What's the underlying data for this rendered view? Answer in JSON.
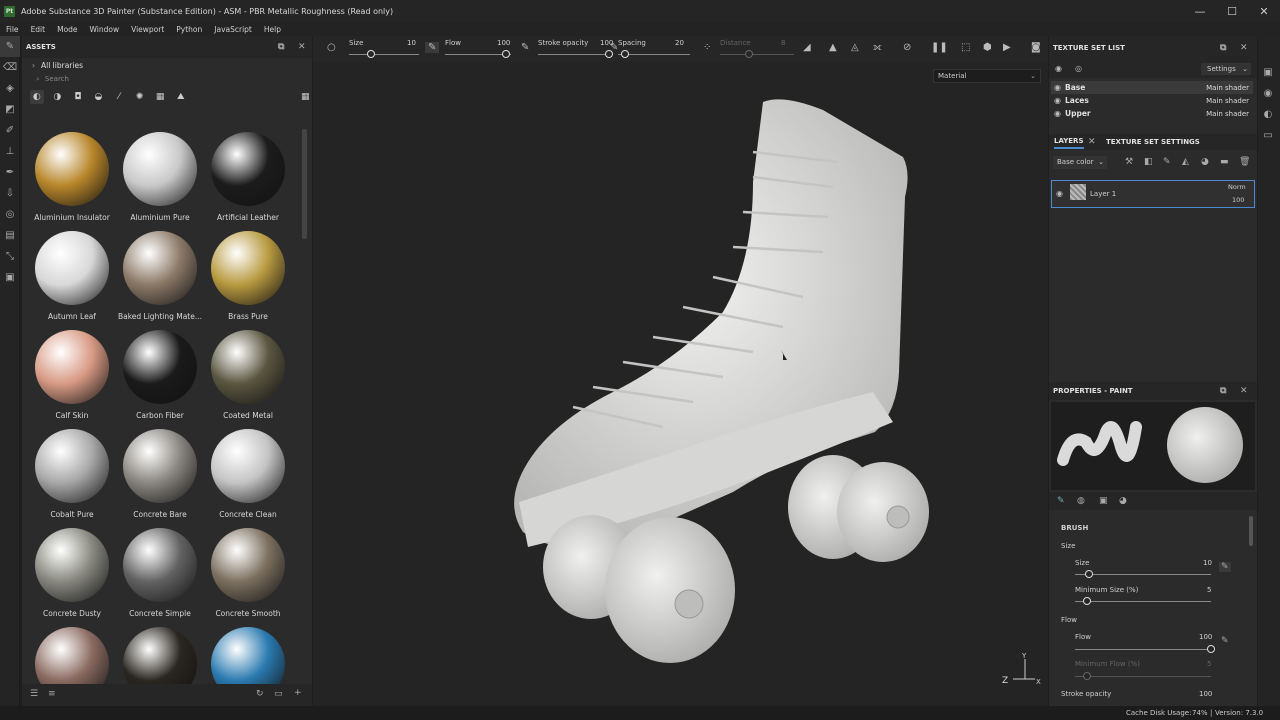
{
  "window": {
    "title": "Adobe Substance 3D Painter (Substance Edition) - ASM - PBR Metallic Roughness (Read only)",
    "icon_text": "Pt",
    "minimize_glyph": "—",
    "maximize_glyph": "☐",
    "close_glyph": "✕"
  },
  "menu": [
    "File",
    "Edit",
    "Mode",
    "Window",
    "Viewport",
    "Python",
    "JavaScript",
    "Help"
  ],
  "assets": {
    "title": "ASSETS",
    "library": "All libraries",
    "search_placeholder": "Search",
    "materials": [
      {
        "label": "Aluminium Insulator",
        "color": "#b8862a"
      },
      {
        "label": "Aluminium Pure",
        "color": "#c8c8c8"
      },
      {
        "label": "Artificial Leather",
        "color": "#1c1c1c"
      },
      {
        "label": "Autumn Leaf",
        "color": "#d8d8d8"
      },
      {
        "label": "Baked Lighting Mate...",
        "color": "#8c7a68"
      },
      {
        "label": "Brass Pure",
        "color": "#b89a40"
      },
      {
        "label": "Calf Skin",
        "color": "#d89a84"
      },
      {
        "label": "Carbon Fiber",
        "color": "#1a1a1a"
      },
      {
        "label": "Coated Metal",
        "color": "#5a5640"
      },
      {
        "label": "Cobalt Pure",
        "color": "#a8a8a8"
      },
      {
        "label": "Concrete Bare",
        "color": "#8a8680"
      },
      {
        "label": "Concrete Clean",
        "color": "#c4c4c4"
      },
      {
        "label": "Concrete Dusty",
        "color": "#888880"
      },
      {
        "label": "Concrete Simple",
        "color": "#626262"
      },
      {
        "label": "Concrete Smooth",
        "color": "#7c7060"
      },
      {
        "label": "",
        "color": "#8a6a60"
      },
      {
        "label": "",
        "color": "#2a2620"
      },
      {
        "label": "",
        "color": "#2a7ab0"
      }
    ]
  },
  "toolbar": {
    "size_label": "Size",
    "size_value": "10",
    "flow_label": "Flow",
    "flow_value": "100",
    "stroke_opacity_label": "Stroke opacity",
    "stroke_opacity_value": "100",
    "spacing_label": "Spacing",
    "spacing_value": "20",
    "distance_label": "Distance",
    "distance_value": "8"
  },
  "viewport": {
    "material_mode": "Material",
    "axis_z": "Z",
    "axis_y": "Y",
    "axis_x": "X"
  },
  "texture_set_list": {
    "title": "TEXTURE SET LIST",
    "settings_label": "Settings",
    "rows": [
      {
        "name": "Base",
        "shader": "Main shader"
      },
      {
        "name": "Laces",
        "shader": "Main shader"
      },
      {
        "name": "Upper",
        "shader": "Main shader"
      }
    ]
  },
  "layers": {
    "tab_layers": "LAYERS",
    "tab_settings": "TEXTURE SET SETTINGS",
    "channel": "Base color",
    "layer_name": "Layer 1",
    "blend_mode": "Norm",
    "opacity": "100"
  },
  "properties": {
    "title": "PROPERTIES - PAINT",
    "brush_section": "BRUSH",
    "size_group": "Size",
    "size_label": "Size",
    "size_value": "10",
    "min_size_label": "Minimum Size (%)",
    "min_size_value": "5",
    "flow_group": "Flow",
    "flow_label": "Flow",
    "flow_value": "100",
    "min_flow_label": "Minimum Flow (%)",
    "min_flow_value": "5",
    "stroke_opacity_label": "Stroke opacity",
    "stroke_opacity_value": "100",
    "size_fraction": 0.1,
    "flow_fraction": 1.0
  },
  "status": {
    "cache_label": "Cache Disk Usage:",
    "cache_value": "74%",
    "version": "Version: 7.3.0"
  }
}
